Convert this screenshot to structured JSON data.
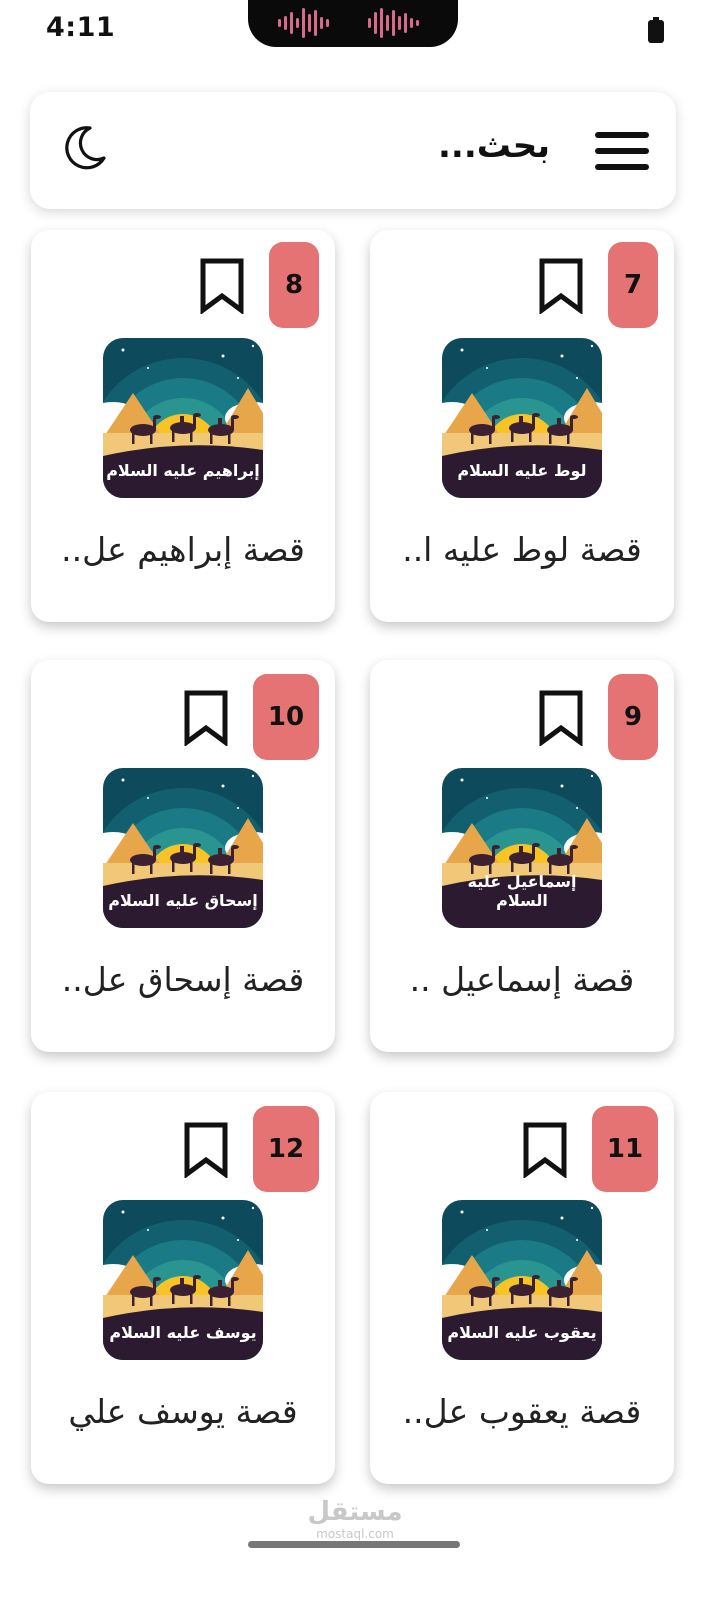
{
  "status_bar": {
    "time": "4:11"
  },
  "header": {
    "search_text": "بحث...",
    "menu_icon": "hamburger-menu-icon",
    "theme_icon": "moon-icon"
  },
  "cards": [
    {
      "number": "7",
      "image_label": "لوط عليه السلام",
      "title": "قصة لوط عليه ا.."
    },
    {
      "number": "8",
      "image_label": "إبراهيم عليه السلام",
      "title": "قصة إبراهيم عل.."
    },
    {
      "number": "9",
      "image_label": "إسماعيل عليه السلام",
      "title": "قصة إسماعيل .."
    },
    {
      "number": "10",
      "image_label": "إسحاق عليه السلام",
      "title": "قصة إسحاق عل.."
    },
    {
      "number": "11",
      "image_label": "يعقوب عليه السلام",
      "title": "قصة يعقوب عل.."
    },
    {
      "number": "12",
      "image_label": "يوسف عليه السلام",
      "title": "قصة يوسف علي"
    }
  ],
  "watermark": {
    "arabic": "مستقل",
    "latin": "mostaql.com"
  },
  "colors": {
    "badge": "#e57373",
    "background": "#ffffff",
    "text": "#111111"
  }
}
